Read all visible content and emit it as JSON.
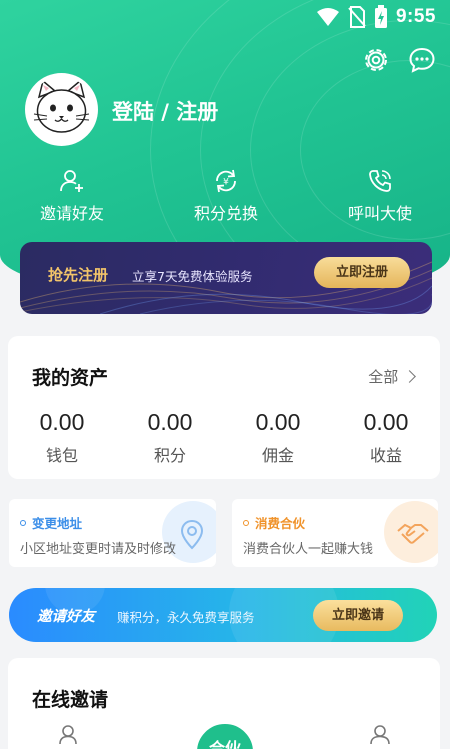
{
  "status_bar": {
    "time": "9:55"
  },
  "profile": {
    "login_label": "登陆 / 注册"
  },
  "quick_actions": [
    {
      "label": "邀请好友",
      "icon": "user-add-icon"
    },
    {
      "label": "积分兑换",
      "icon": "exchange-icon"
    },
    {
      "label": "呼叫大使",
      "icon": "phone-icon"
    }
  ],
  "promo_banner": {
    "title": "抢先注册",
    "subtitle": "立享7天免费体验服务",
    "button": "立即注册"
  },
  "assets": {
    "title": "我的资产",
    "all_label": "全部",
    "items": [
      {
        "value": "0.00",
        "label": "钱包"
      },
      {
        "value": "0.00",
        "label": "积分"
      },
      {
        "value": "0.00",
        "label": "佣金"
      },
      {
        "value": "0.00",
        "label": "收益"
      }
    ]
  },
  "cards": [
    {
      "title": "变更地址",
      "desc": "小区地址变更时请及时修改",
      "icon": "location-icon",
      "color": "#3b8ee8"
    },
    {
      "title": "消费合伙",
      "desc": "消费合伙人一起赚大钱",
      "icon": "handshake-icon",
      "color": "#f0932b"
    }
  ],
  "invite_banner": {
    "title": "邀请好友",
    "subtitle": "赚积分，永久免费享服务",
    "button": "立即邀请"
  },
  "online_invite": {
    "title": "在线邀请"
  },
  "fab": {
    "label": "合伙"
  },
  "colors": {
    "brand": "#21c493",
    "promo_bg": "#2b2b62",
    "gold": "#e5b55a"
  }
}
